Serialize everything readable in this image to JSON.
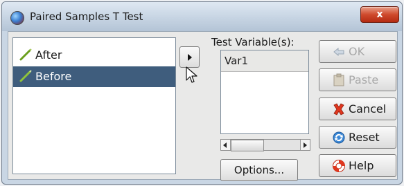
{
  "window": {
    "title": "Paired Samples T Test",
    "close_label": "x"
  },
  "variables": [
    {
      "label": "After",
      "selected": false
    },
    {
      "label": "Before",
      "selected": true
    }
  ],
  "test_variables": {
    "label": "Test Variable(s):",
    "items": [
      "Var1"
    ]
  },
  "buttons": {
    "options": "Options...",
    "ok": "OK",
    "paste": "Paste",
    "cancel": "Cancel",
    "reset": "Reset",
    "help": "Help"
  },
  "colors": {
    "selection": "#3f5d7d",
    "close": "#cf4a2d",
    "disabled_text": "#a8a8a8"
  }
}
